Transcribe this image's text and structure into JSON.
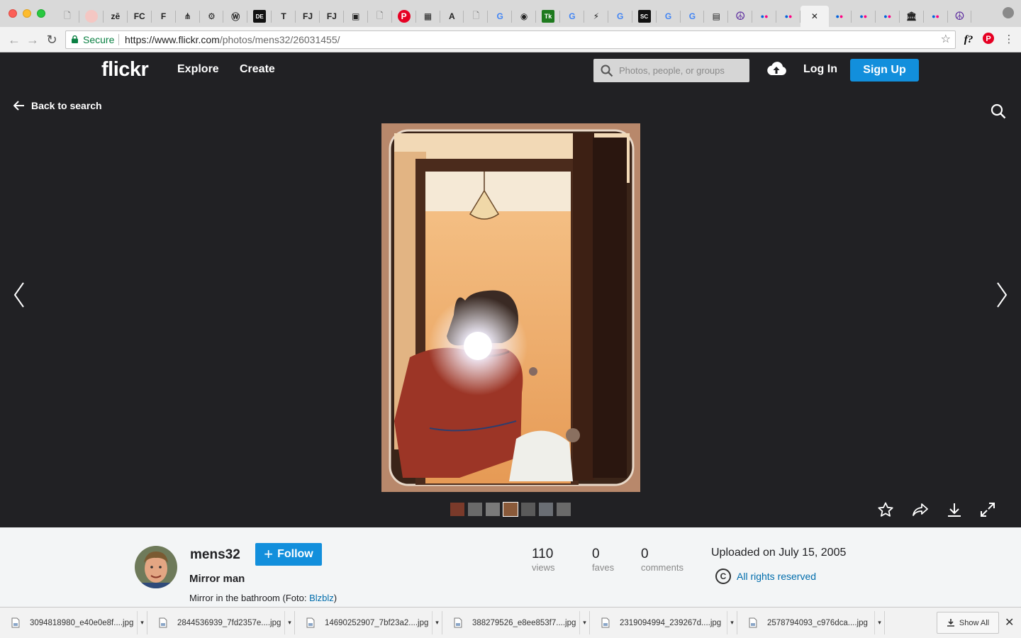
{
  "browser": {
    "tabs": [
      {
        "icon": "doc-icon",
        "glyph": "🗋"
      },
      {
        "icon": "circle-favicon-icon",
        "glyph": ""
      },
      {
        "icon": "translate-icon",
        "glyph": "zē"
      },
      {
        "icon": "fc-favicon-icon",
        "glyph": "FC"
      },
      {
        "icon": "f-favicon-icon",
        "glyph": "F"
      },
      {
        "icon": "network-favicon-icon",
        "glyph": "⋔"
      },
      {
        "icon": "settings-favicon-icon",
        "glyph": "⚙"
      },
      {
        "icon": "wp-favicon-icon",
        "glyph": "Ⓦ"
      },
      {
        "icon": "dict-favicon-icon",
        "glyph": "DE"
      },
      {
        "icon": "t-favicon-icon",
        "glyph": "T"
      },
      {
        "icon": "fj-favicon-icon",
        "glyph": "FJ"
      },
      {
        "icon": "fj-favicon-icon",
        "glyph": "FJ"
      },
      {
        "icon": "image-favicon-icon",
        "glyph": "▣"
      },
      {
        "icon": "doc-icon",
        "glyph": "🗋"
      },
      {
        "icon": "pinterest-favicon-icon",
        "glyph": "P"
      },
      {
        "icon": "blue-favicon-icon",
        "glyph": "▦"
      },
      {
        "icon": "a-favicon-icon",
        "glyph": "A"
      },
      {
        "icon": "doc-icon",
        "glyph": "🗋"
      },
      {
        "icon": "google-favicon-icon",
        "glyph": "G"
      },
      {
        "icon": "eye-favicon-icon",
        "glyph": "◉"
      },
      {
        "icon": "tk-favicon-icon",
        "glyph": "Tk"
      },
      {
        "icon": "google-favicon-icon",
        "glyph": "G"
      },
      {
        "icon": "bolt-favicon-icon",
        "glyph": "⚡"
      },
      {
        "icon": "google-favicon-icon",
        "glyph": "G"
      },
      {
        "icon": "sc-favicon-icon",
        "glyph": "SC"
      },
      {
        "icon": "google-favicon-icon",
        "glyph": "G"
      },
      {
        "icon": "google-favicon-icon",
        "glyph": "G"
      },
      {
        "icon": "bag-favicon-icon",
        "glyph": "▤"
      },
      {
        "icon": "peace-favicon-icon",
        "glyph": "☮"
      },
      {
        "icon": "flickr-favicon-icon",
        "glyph": "●●"
      },
      {
        "icon": "flickr-favicon-icon",
        "glyph": "●●"
      },
      {
        "icon": "close-tab-icon",
        "glyph": "✕",
        "active": true
      },
      {
        "icon": "flickr-favicon-icon",
        "glyph": "●●"
      },
      {
        "icon": "flickr-favicon-icon",
        "glyph": "●●"
      },
      {
        "icon": "flickr-favicon-icon",
        "glyph": "●●"
      },
      {
        "icon": "archive-favicon-icon",
        "glyph": "🏛"
      },
      {
        "icon": "flickr-favicon-icon",
        "glyph": "●●"
      },
      {
        "icon": "peace-favicon-icon",
        "glyph": "☮"
      }
    ],
    "url_secure_label": "Secure",
    "url_host": "https://www.flickr.com",
    "url_path": "/photos/mens32/26031455/",
    "ext_font": "f?"
  },
  "header": {
    "logo": "flickr",
    "nav": [
      "Explore",
      "Create"
    ],
    "search_placeholder": "Photos, people, or groups",
    "login": "Log In",
    "signup": "Sign Up"
  },
  "stage": {
    "back_label": "Back to search",
    "thumb_count": 7,
    "selected_thumb": 3
  },
  "info": {
    "owner": "mens32",
    "follow": "Follow",
    "title": "Mirror man",
    "description_prefix": "Mirror in the bathroom (Foto: ",
    "description_link": "Blzblz",
    "description_suffix": ")",
    "stats": [
      {
        "num": "110",
        "label": "views"
      },
      {
        "num": "0",
        "label": "faves"
      },
      {
        "num": "0",
        "label": "comments"
      }
    ],
    "uploaded": "Uploaded on July 15, 2005",
    "license": "All rights reserved"
  },
  "downloads": {
    "files": [
      "3094818980_e40e0e8f....jpg",
      "2844536939_7fd2357e....jpg",
      "14690252907_7bf23a2....jpg",
      "388279526_e8ee853f7....jpg",
      "2319094994_239267d....jpg",
      "2578794093_c976dca....jpg"
    ],
    "show_all": "Show All"
  },
  "colors": {
    "flickr_blue": "#128fdc",
    "flickr_pink": "#ff0084",
    "link": "#006dac",
    "stage_bg": "#212124"
  }
}
